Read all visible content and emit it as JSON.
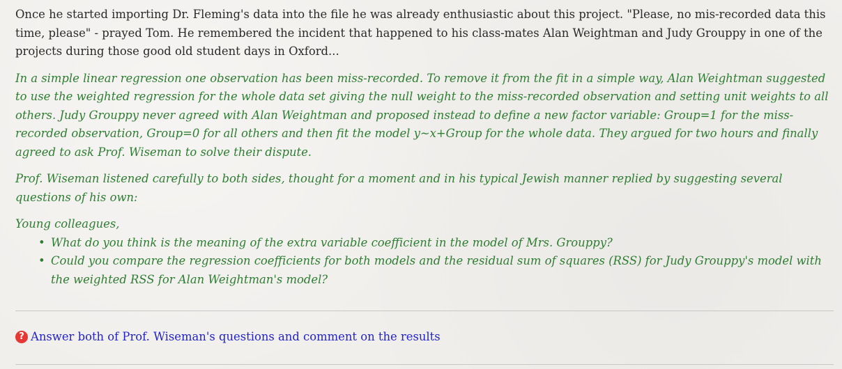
{
  "intro": "Once he started importing Dr. Fleming's data into the file he was already enthusiastic about this project. \"Please, no mis-recorded data this time, please\" - prayed Tom. He remembered the incident that happened to his class-mates Alan Weightman and Judy Grouppy in one of the projects during those good old student days in Oxford...",
  "story": {
    "paragraph_1": "In a simple linear regression one observation has been miss-recorded. To remove it from the fit in a simple way, Alan Weightman suggested to use the weighted regression for the whole data set giving the null weight to the miss-recorded observation and setting unit weights to all others. Judy Grouppy never agreed with Alan Weightman and proposed instead to define a new factor variable: Group=1 for the miss-recorded observation, Group=0 for all others and then fit the model y~x+Group for the whole data. They argued for two hours and finally agreed to ask Prof. Wiseman to solve their dispute.",
    "paragraph_2": "Prof. Wiseman listened carefully to both sides, thought for a moment and in his typical Jewish manner replied by suggesting several questions of his own:",
    "salutation": "Young colleagues,",
    "questions": [
      "What do you think is the meaning of the extra variable coefficient in the model of Mrs. Grouppy?",
      "Could you compare the regression coefficients for both models and the residual sum of squares (RSS) for Judy Grouppy's model with the weighted RSS for Alan Weightman's model?"
    ]
  },
  "task": {
    "icon": "question-circle-icon",
    "icon_glyph": "?",
    "icon_color": "#e53935",
    "link_text": "Answer both of Prof. Wiseman's questions and comment on the results"
  },
  "colors": {
    "story_text": "#2e7d32",
    "link": "#2323c8",
    "background": "#f1efec"
  }
}
